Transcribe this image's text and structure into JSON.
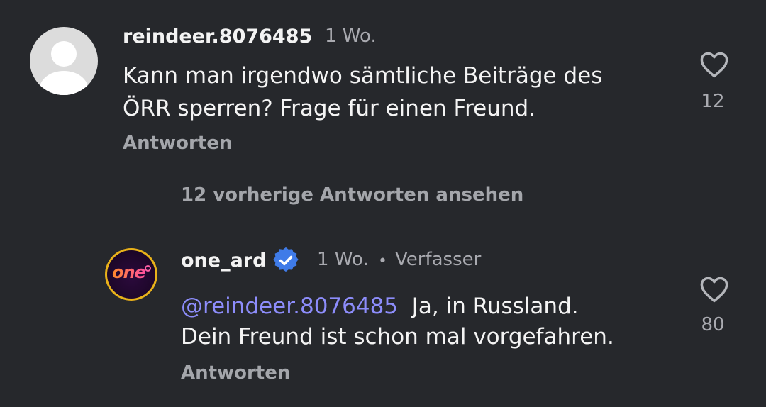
{
  "comment": {
    "username": "reindeer.8076485",
    "time": "1 Wo.",
    "text_line1": "Kann man irgendwo sämtliche Beiträge des",
    "text_line2": "ÖRR sperren? Frage für einen Freund.",
    "reply_label": "Antworten",
    "like_count": "12",
    "avatar_icon": "default-user-icon",
    "like_icon": "heart-outline-icon"
  },
  "view_replies_label": "12 vorherige Antworten ansehen",
  "reply": {
    "username": "one_ard",
    "verified_icon": "verified-badge-icon",
    "time": "1 Wo.",
    "separator": "•",
    "author_label": "Verfasser",
    "mention": "@reindeer.8076485",
    "text_line1_rest": "Ja, in Russland.",
    "text_line2": "Dein Freund ist schon mal vorgefahren.",
    "reply_label": "Antworten",
    "like_count": "80",
    "avatar_brand_text": "one",
    "like_icon": "heart-outline-icon"
  },
  "colors": {
    "background": "#26282c",
    "mention": "#8d8dfb",
    "verified": "#3f7be8",
    "secondary_text": "#a9aab0"
  }
}
